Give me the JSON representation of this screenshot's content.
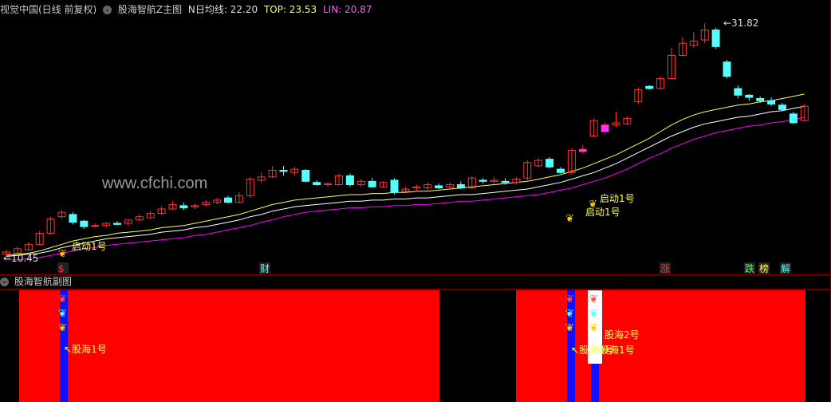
{
  "header": {
    "title": "视觉中国(日线 前复权)",
    "indicator": "股海智航Z主图",
    "ma_label": "N日均线: 22.20",
    "top_label": "TOP: 23.53",
    "lin_label": "LIN: 20.87"
  },
  "sub_header": {
    "title": "股海智航副图"
  },
  "watermark": "www.cfchi.com",
  "annotations": {
    "low": "←10.45",
    "high": "←31.82",
    "launch": "启动1号",
    "launch_b": "启动1号",
    "launch_c": "启动1号",
    "gh1": "股海1号",
    "gh2": "股海2号",
    "gh1b": "股海1号",
    "gh0": "股海0号"
  },
  "markers": [
    "$",
    "财",
    "涨",
    "跌",
    "榜",
    "解"
  ],
  "colors": {
    "up": "#ff3232",
    "down": "#54ffff",
    "ma": "#ffff50",
    "top": "#ffffff",
    "lin": "#ff00ff",
    "grid": "#7a0000"
  },
  "chart_data": {
    "type": "candlestick",
    "title": "视觉中国(日线 前复权)",
    "price_range": [
      10.45,
      31.82
    ],
    "candles": [
      {
        "o": 10.9,
        "c": 11.1,
        "h": 11.3,
        "l": 10.7
      },
      {
        "o": 11.0,
        "c": 11.4,
        "h": 11.6,
        "l": 10.9
      },
      {
        "o": 11.3,
        "c": 11.8,
        "h": 12.0,
        "l": 11.2
      },
      {
        "o": 11.8,
        "c": 12.8,
        "h": 13.0,
        "l": 11.7
      },
      {
        "o": 12.8,
        "c": 14.1,
        "h": 14.3,
        "l": 12.7
      },
      {
        "o": 14.3,
        "c": 14.7,
        "h": 14.9,
        "l": 14.1
      },
      {
        "o": 14.5,
        "c": 13.8,
        "h": 14.7,
        "l": 13.6
      },
      {
        "o": 13.9,
        "c": 13.4,
        "h": 14.0,
        "l": 13.2
      },
      {
        "o": 13.5,
        "c": 13.5,
        "h": 13.7,
        "l": 13.3
      },
      {
        "o": 13.5,
        "c": 13.7,
        "h": 13.8,
        "l": 13.3
      },
      {
        "o": 13.7,
        "c": 13.6,
        "h": 13.9,
        "l": 13.5
      },
      {
        "o": 13.7,
        "c": 14.0,
        "h": 14.1,
        "l": 13.5
      },
      {
        "o": 14.0,
        "c": 14.3,
        "h": 14.5,
        "l": 13.9
      },
      {
        "o": 14.2,
        "c": 14.6,
        "h": 14.8,
        "l": 14.1
      },
      {
        "o": 14.6,
        "c": 15.0,
        "h": 15.2,
        "l": 14.5
      },
      {
        "o": 15.0,
        "c": 15.4,
        "h": 15.7,
        "l": 14.9
      },
      {
        "o": 15.3,
        "c": 15.1,
        "h": 15.6,
        "l": 14.9
      },
      {
        "o": 15.2,
        "c": 15.3,
        "h": 15.5,
        "l": 15.0
      },
      {
        "o": 15.4,
        "c": 15.6,
        "h": 15.8,
        "l": 15.2
      },
      {
        "o": 15.6,
        "c": 15.8,
        "h": 16.0,
        "l": 15.4
      },
      {
        "o": 16.0,
        "c": 15.6,
        "h": 16.2,
        "l": 15.5
      },
      {
        "o": 15.6,
        "c": 16.2,
        "h": 16.5,
        "l": 15.5
      },
      {
        "o": 16.2,
        "c": 17.7,
        "h": 17.9,
        "l": 16.0
      },
      {
        "o": 17.6,
        "c": 17.9,
        "h": 18.3,
        "l": 17.4
      },
      {
        "o": 17.9,
        "c": 18.5,
        "h": 18.9,
        "l": 17.8
      },
      {
        "o": 18.5,
        "c": 18.4,
        "h": 18.9,
        "l": 18.0
      },
      {
        "o": 18.3,
        "c": 18.6,
        "h": 18.8,
        "l": 18.0
      },
      {
        "o": 18.5,
        "c": 17.5,
        "h": 18.6,
        "l": 17.4
      },
      {
        "o": 17.4,
        "c": 17.2,
        "h": 17.6,
        "l": 17.1
      },
      {
        "o": 17.2,
        "c": 17.3,
        "h": 17.4,
        "l": 17.0
      },
      {
        "o": 17.2,
        "c": 18.0,
        "h": 18.2,
        "l": 17.1
      },
      {
        "o": 18.0,
        "c": 17.2,
        "h": 18.2,
        "l": 17.0
      },
      {
        "o": 17.2,
        "c": 17.5,
        "h": 17.7,
        "l": 17.0
      },
      {
        "o": 17.5,
        "c": 17.0,
        "h": 17.8,
        "l": 16.9
      },
      {
        "o": 17.0,
        "c": 17.4,
        "h": 17.5,
        "l": 16.9
      },
      {
        "o": 17.6,
        "c": 16.5,
        "h": 17.8,
        "l": 16.3
      },
      {
        "o": 16.6,
        "c": 16.8,
        "h": 17.0,
        "l": 16.5
      },
      {
        "o": 16.9,
        "c": 17.0,
        "h": 17.2,
        "l": 16.6
      },
      {
        "o": 16.9,
        "c": 17.2,
        "h": 17.4,
        "l": 16.7
      },
      {
        "o": 17.1,
        "c": 16.9,
        "h": 17.3,
        "l": 16.8
      },
      {
        "o": 17.0,
        "c": 17.2,
        "h": 17.4,
        "l": 16.8
      },
      {
        "o": 17.2,
        "c": 16.9,
        "h": 17.5,
        "l": 16.8
      },
      {
        "o": 16.9,
        "c": 17.8,
        "h": 18.0,
        "l": 16.8
      },
      {
        "o": 17.6,
        "c": 17.5,
        "h": 17.8,
        "l": 17.3
      },
      {
        "o": 17.5,
        "c": 17.6,
        "h": 17.9,
        "l": 17.3
      },
      {
        "o": 17.5,
        "c": 17.4,
        "h": 17.8,
        "l": 17.2
      },
      {
        "o": 17.4,
        "c": 17.7,
        "h": 17.9,
        "l": 17.2
      },
      {
        "o": 17.8,
        "c": 19.2,
        "h": 19.4,
        "l": 17.6
      },
      {
        "o": 18.9,
        "c": 19.4,
        "h": 19.6,
        "l": 18.8
      },
      {
        "o": 19.5,
        "c": 18.8,
        "h": 19.7,
        "l": 18.7
      },
      {
        "o": 18.6,
        "c": 18.3,
        "h": 18.8,
        "l": 18.2
      },
      {
        "o": 18.3,
        "c": 20.3,
        "h": 20.5,
        "l": 18.1
      },
      {
        "o": 20.2,
        "c": 20.4,
        "h": 20.8,
        "l": 20.0
      },
      {
        "o": 21.6,
        "c": 23.0,
        "h": 23.2,
        "l": 21.5
      },
      {
        "o": 22.0,
        "c": 22.6,
        "h": 22.8,
        "l": 21.9
      },
      {
        "o": 22.6,
        "c": 22.8,
        "h": 23.8,
        "l": 22.4
      },
      {
        "o": 22.7,
        "c": 23.2,
        "h": 23.4,
        "l": 22.6
      },
      {
        "o": 24.7,
        "c": 25.8,
        "h": 26.0,
        "l": 24.5
      },
      {
        "o": 26.1,
        "c": 25.9,
        "h": 26.2,
        "l": 25.8
      },
      {
        "o": 25.9,
        "c": 26.8,
        "h": 27.0,
        "l": 25.8
      },
      {
        "o": 26.8,
        "c": 28.9,
        "h": 29.6,
        "l": 26.7
      },
      {
        "o": 28.9,
        "c": 30.0,
        "h": 30.6,
        "l": 28.8
      },
      {
        "o": 29.8,
        "c": 30.2,
        "h": 31.0,
        "l": 29.6
      },
      {
        "o": 30.3,
        "c": 31.2,
        "h": 31.82,
        "l": 30.0
      },
      {
        "o": 31.2,
        "c": 29.7,
        "h": 31.4,
        "l": 29.5
      },
      {
        "o": 28.3,
        "c": 27.0,
        "h": 28.5,
        "l": 26.8
      },
      {
        "o": 25.9,
        "c": 25.3,
        "h": 26.2,
        "l": 25.0
      },
      {
        "o": 25.3,
        "c": 25.1,
        "h": 25.4,
        "l": 24.8
      },
      {
        "o": 25.0,
        "c": 24.8,
        "h": 25.2,
        "l": 24.6
      },
      {
        "o": 24.8,
        "c": 24.5,
        "h": 25.1,
        "l": 24.3
      },
      {
        "o": 24.4,
        "c": 24.0,
        "h": 24.6,
        "l": 23.9
      },
      {
        "o": 23.6,
        "c": 22.8,
        "h": 23.8,
        "l": 22.7
      },
      {
        "o": 23.0,
        "c": 24.3,
        "h": 24.5,
        "l": 22.9
      }
    ],
    "ma_series": [
      10.8,
      10.9,
      11.0,
      11.2,
      11.5,
      11.8,
      12.1,
      12.3,
      12.5,
      12.6,
      12.8,
      12.9,
      13.0,
      13.1,
      13.3,
      13.4,
      13.5,
      13.7,
      13.9,
      14.1,
      14.3,
      14.5,
      14.8,
      15.1,
      15.4,
      15.6,
      15.8,
      15.9,
      16.0,
      16.1,
      16.2,
      16.3,
      16.3,
      16.4,
      16.4,
      16.5,
      16.5,
      16.6,
      16.6,
      16.7,
      16.8,
      16.9,
      17.0,
      17.1,
      17.2,
      17.3,
      17.4,
      17.5,
      17.7,
      17.9,
      18.1,
      18.4,
      18.7,
      19.1,
      19.5,
      19.9,
      20.4,
      20.9,
      21.4,
      22.0,
      22.6,
      23.1,
      23.5,
      23.8,
      24.0,
      24.2,
      24.4,
      24.5,
      24.7,
      24.8,
      25.0,
      25.2,
      25.4
    ],
    "top_series": [
      10.7,
      10.8,
      10.9,
      11.0,
      11.2,
      11.5,
      11.7,
      11.9,
      12.1,
      12.3,
      12.4,
      12.5,
      12.6,
      12.7,
      12.9,
      13.0,
      13.1,
      13.3,
      13.4,
      13.6,
      13.8,
      14.0,
      14.3,
      14.5,
      14.8,
      15.0,
      15.2,
      15.3,
      15.4,
      15.5,
      15.6,
      15.7,
      15.7,
      15.8,
      15.8,
      15.9,
      15.9,
      16.0,
      16.0,
      16.1,
      16.2,
      16.3,
      16.3,
      16.4,
      16.5,
      16.6,
      16.7,
      16.8,
      17.0,
      17.2,
      17.4,
      17.7,
      18.0,
      18.3,
      18.7,
      19.1,
      19.6,
      20.1,
      20.6,
      21.1,
      21.6,
      22.0,
      22.4,
      22.7,
      22.9,
      23.1,
      23.3,
      23.4,
      23.6,
      23.8,
      23.9,
      24.1,
      24.3
    ],
    "lin_series": [
      10.4,
      10.4,
      10.5,
      10.6,
      10.8,
      11.0,
      11.2,
      11.4,
      11.5,
      11.7,
      11.8,
      11.9,
      12.0,
      12.1,
      12.2,
      12.3,
      12.4,
      12.6,
      12.7,
      12.9,
      13.1,
      13.3,
      13.5,
      13.8,
      14.0,
      14.3,
      14.5,
      14.7,
      14.8,
      14.9,
      15.0,
      15.1,
      15.1,
      15.2,
      15.2,
      15.3,
      15.3,
      15.4,
      15.4,
      15.5,
      15.6,
      15.7,
      15.7,
      15.8,
      15.9,
      16.0,
      16.1,
      16.2,
      16.3,
      16.5,
      16.7,
      16.9,
      17.2,
      17.5,
      17.8,
      18.2,
      18.6,
      19.1,
      19.6,
      20.0,
      20.5,
      20.9,
      21.3,
      21.6,
      21.9,
      22.1,
      22.3,
      22.5,
      22.6,
      22.8,
      22.9,
      23.1,
      23.3
    ],
    "legend": [
      "N日均线",
      "TOP",
      "LIN"
    ]
  }
}
